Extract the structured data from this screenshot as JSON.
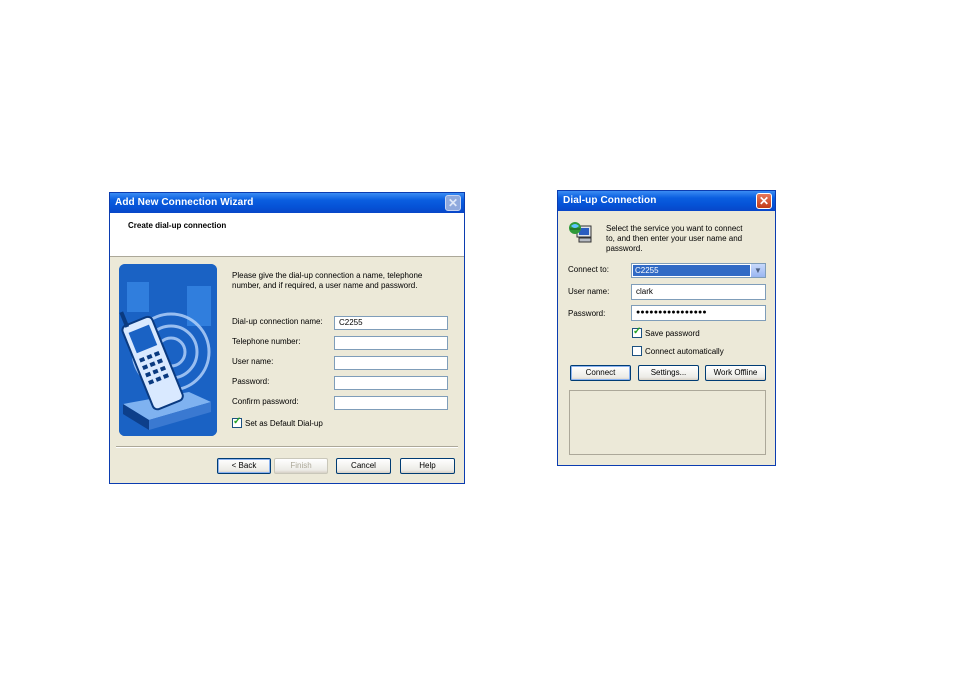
{
  "wizard": {
    "title": "Add New Connection Wizard",
    "header": "Create dial-up connection",
    "intro_line1": "Please give the dial-up connection a name, telephone",
    "intro_line2": "number, and if required, a user name and password.",
    "fields": {
      "connection_name_label": "Dial-up connection name:",
      "connection_name_value": "C2255",
      "telephone_label": "Telephone number:",
      "telephone_value": "",
      "username_label": "User name:",
      "username_value": "",
      "password_label": "Password:",
      "password_value": "",
      "confirm_label": "Confirm password:",
      "confirm_value": ""
    },
    "default_checkbox_label": "Set as Default Dial-up",
    "default_checked": true,
    "buttons": {
      "back": "< Back",
      "finish": "Finish",
      "cancel": "Cancel",
      "help": "Help"
    }
  },
  "dialup": {
    "title": "Dial-up Connection",
    "intro_line1": "Select the service you want to connect",
    "intro_line2": "to, and then enter your user name and",
    "intro_line3": "password.",
    "connect_to_label": "Connect to:",
    "connect_to_value": "C2255",
    "username_label": "User name:",
    "username_value": "clark",
    "password_label": "Password:",
    "password_value": "●●●●●●●●●●●●●●●●",
    "save_password_label": "Save password",
    "save_password_checked": true,
    "connect_auto_label": "Connect automatically",
    "connect_auto_checked": false,
    "buttons": {
      "connect": "Connect",
      "settings": "Settings...",
      "offline": "Work Offline"
    }
  },
  "colors": {
    "titlebar": "#0a5ee0",
    "dialog_bg": "#ece9d8",
    "illustration": "#1d6fd0"
  },
  "icons": [
    "close-icon",
    "phone-illustration",
    "network-computer-icon",
    "dropdown-arrow-icon",
    "checkmark-icon"
  ]
}
